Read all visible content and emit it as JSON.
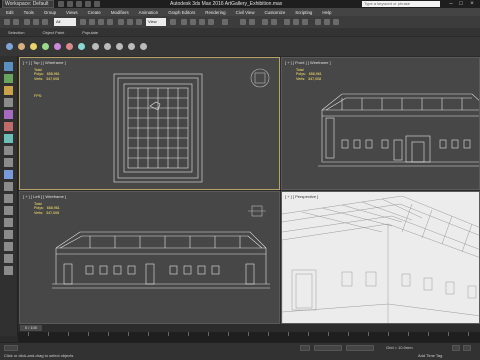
{
  "titlebar": {
    "workspace": "Workspace: Default",
    "title": "Autodesk 3ds Max 2016    ArtGallery_Exhibition.max",
    "search_placeholder": "Type a keyword or phrase"
  },
  "menubar": {
    "items": [
      "Edit",
      "Tools",
      "Group",
      "Views",
      "Create",
      "Modifiers",
      "Animation",
      "Graph Editors",
      "Rendering",
      "Civil View",
      "Customize",
      "Scripting",
      "Help"
    ]
  },
  "toolbar": {
    "filter_value": "All",
    "view_value": "View"
  },
  "ribbon": {
    "tabs": [
      "Selection",
      "Object Paint",
      "Populate"
    ]
  },
  "viewports": {
    "top": {
      "label": "[ + ] [ Top ] [ Wireframe ]",
      "stats_total": "Total",
      "stats_polys": "Polys:   658,961",
      "stats_verts": "Verts:   347,008",
      "fps": "FPS:"
    },
    "front": {
      "label": "[ + ] [ Front ] [ Wireframe ]",
      "stats_total": "Total",
      "stats_polys": "Polys:   658,961",
      "stats_verts": "Verts:   347,008"
    },
    "left": {
      "label": "[ + ] [ Left ] [ Wireframe ]",
      "stats_total": "Total",
      "stats_polys": "Polys:   658,961",
      "stats_verts": "Verts:   347,008"
    },
    "perspective": {
      "label": "[ + ] [ Perspective ]"
    }
  },
  "timeslider": {
    "value": "0 / 100"
  },
  "statusbar": {
    "message": "Click or click-and-drag to select objects",
    "add_time_tag": "Add Time Tag",
    "grid": "Grid = 10.0mm"
  }
}
